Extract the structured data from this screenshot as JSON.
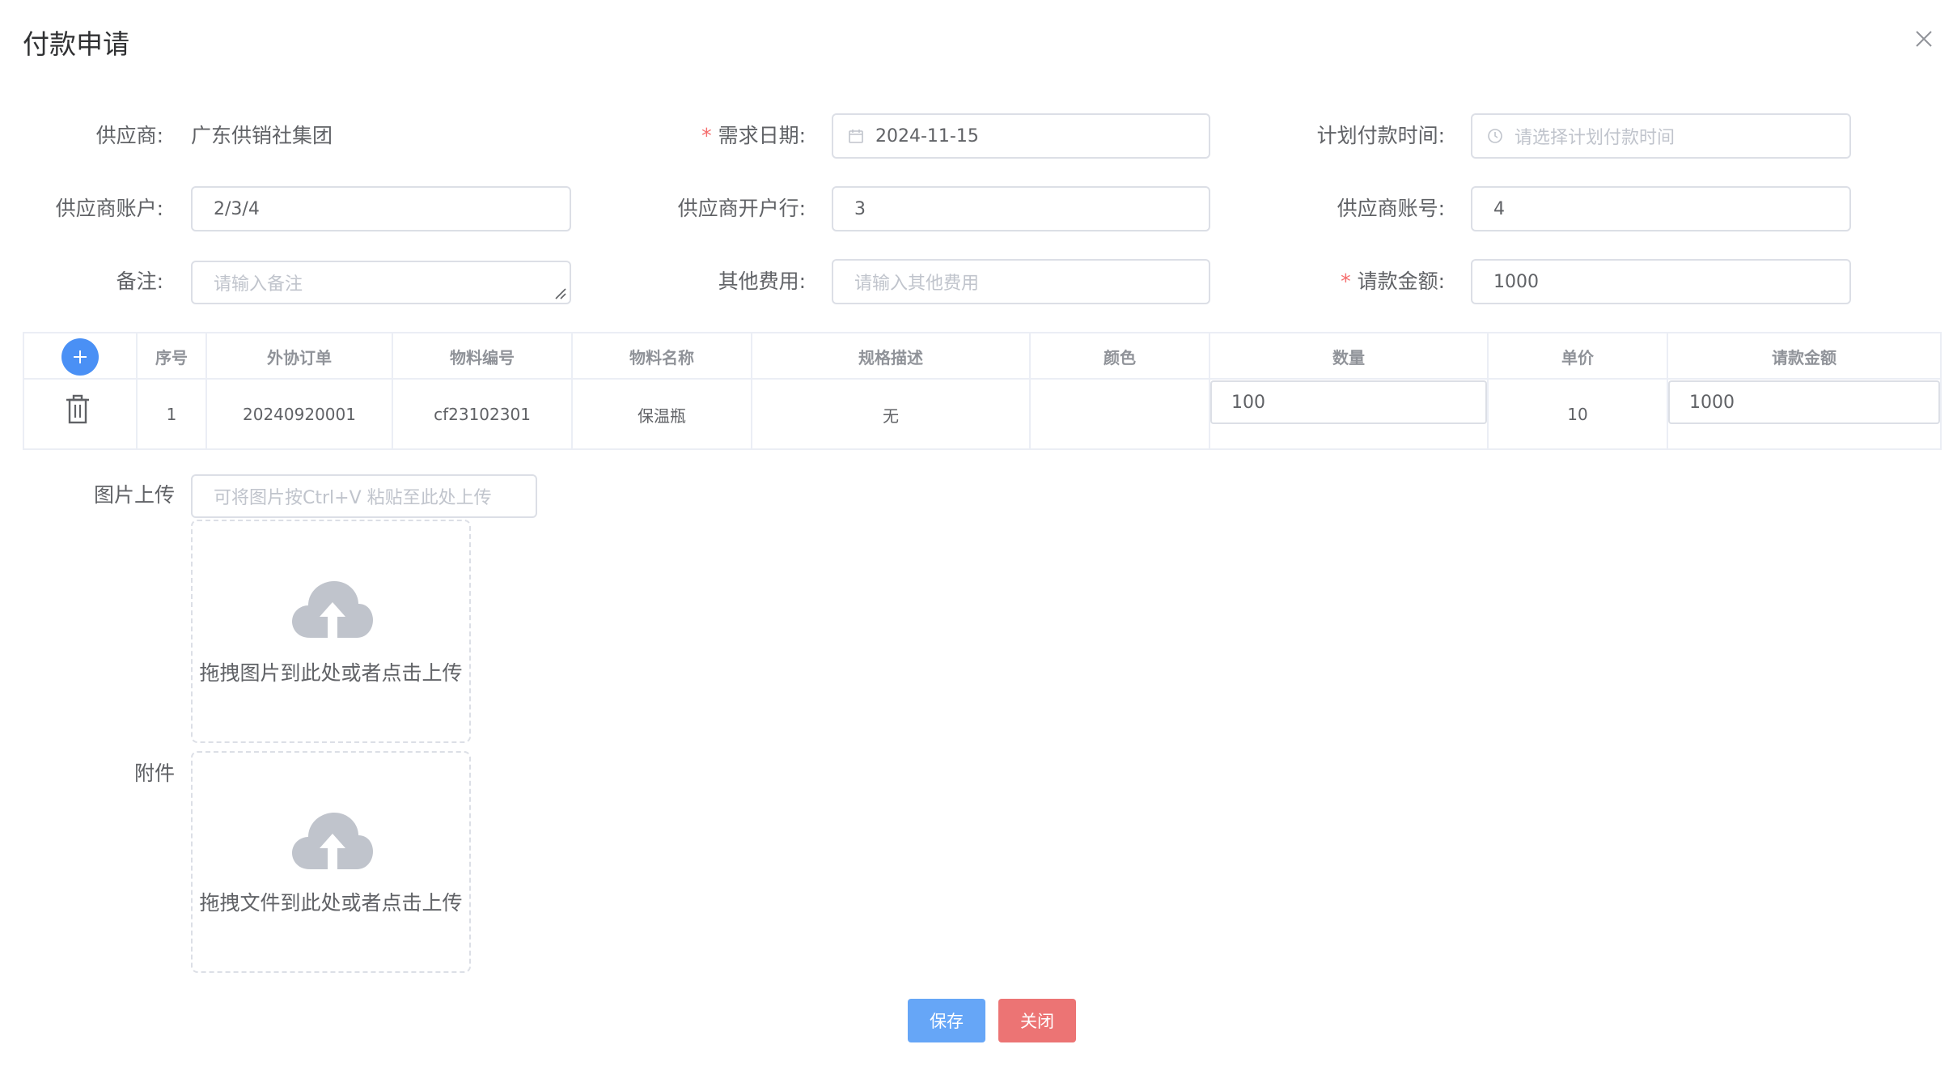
{
  "dialog": {
    "title": "付款申请"
  },
  "form": {
    "supplier_label": "供应商:",
    "supplier_value": "广东供销社集团",
    "demand_date_label": "需求日期:",
    "demand_date_value": "2024-11-15",
    "plan_pay_time_label": "计划付款时间:",
    "plan_pay_time_placeholder": "请选择计划付款时间",
    "supplier_account_label": "供应商账户:",
    "supplier_account_value": "2/3/4",
    "supplier_bank_label": "供应商开户行:",
    "supplier_bank_value": "3",
    "supplier_account_no_label": "供应商账号:",
    "supplier_account_no_value": "4",
    "remark_label": "备注:",
    "remark_placeholder": "请输入备注",
    "other_fee_label": "其他费用:",
    "other_fee_placeholder": "请输入其他费用",
    "request_amount_label": "请款金额:",
    "request_amount_value": "1000",
    "required_mark": "*"
  },
  "table": {
    "headers": [
      "序号",
      "外协订单",
      "物料编号",
      "物料名称",
      "规格描述",
      "颜色",
      "数量",
      "单价",
      "请款金额"
    ],
    "rows": [
      {
        "index": "1",
        "order": "20240920001",
        "material_code": "cf23102301",
        "material_name": "保温瓶",
        "spec": "无",
        "color": "",
        "quantity": "100",
        "unit_price": "10",
        "amount": "1000"
      }
    ]
  },
  "uploads": {
    "image_label": "图片上传",
    "image_paste_placeholder": "可将图片按Ctrl+V 粘贴至此处上传",
    "image_drop_text": "拖拽图片到此处或者点击上传",
    "attachment_label": "附件",
    "attachment_drop_text": "拖拽文件到此处或者点击上传"
  },
  "footer": {
    "save_label": "保存",
    "close_label": "关闭"
  },
  "colors": {
    "primary": "#66a6f7",
    "danger": "#ec7474",
    "add_button": "#4a90f5",
    "required": "#f56c6c",
    "border": "#dcdfe6",
    "placeholder": "#c0c4cc"
  }
}
